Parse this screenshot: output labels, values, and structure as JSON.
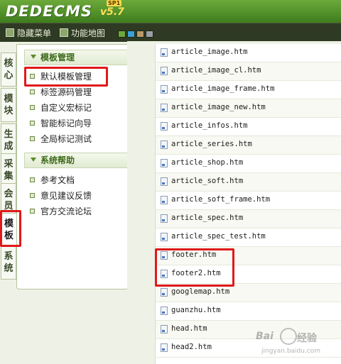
{
  "header": {
    "logo_text": "DEDECMS",
    "version": "v5.7",
    "edition": "SP1"
  },
  "toolbar": {
    "hide_menu": "隐藏菜单",
    "sitemap": "功能地图",
    "theme_colors": [
      "#6ca93a",
      "#3aa0d8",
      "#b89a6a",
      "#9aa0a8"
    ]
  },
  "vtabs": [
    {
      "label": "核心"
    },
    {
      "label": "模块"
    },
    {
      "label": "生成"
    },
    {
      "label": "采集"
    },
    {
      "label": "会员"
    },
    {
      "label": "模板"
    },
    {
      "label": "系统"
    }
  ],
  "sidebar": {
    "section1": {
      "title": "模板管理",
      "items": [
        "默认模板管理",
        "标签源码管理",
        "自定义宏标记",
        "智能标记向导",
        "全局标记测试"
      ]
    },
    "section2": {
      "title": "系统帮助",
      "items": [
        "参考文档",
        "意见建议反馈",
        "官方交流论坛"
      ]
    }
  },
  "files": [
    "article_image.htm",
    "article_image_cl.htm",
    "article_image_frame.htm",
    "article_image_new.htm",
    "article_infos.htm",
    "article_series.htm",
    "article_shop.htm",
    "article_soft.htm",
    "article_soft_frame.htm",
    "article_spec.htm",
    "article_spec_test.htm",
    "footer.htm",
    "footer2.htm",
    "googlemap.htm",
    "guanzhu.htm",
    "head.htm",
    "head2.htm"
  ],
  "watermark": {
    "brand": "Bai",
    "brand2": "经验",
    "url": "jingyan.baidu.com"
  }
}
